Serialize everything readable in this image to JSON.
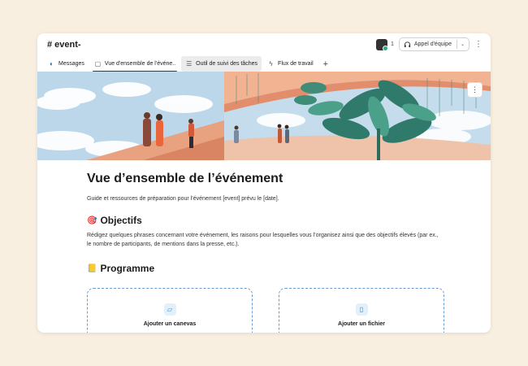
{
  "header": {
    "channel": "# event-",
    "member_count": "1",
    "call_button": "Appel d'équipe"
  },
  "tabs": [
    {
      "label": "Messages",
      "icon": "messages-icon"
    },
    {
      "label": "Vue d'ensemble de l'événe..",
      "icon": "canvas-icon"
    },
    {
      "label": "Outil de suivi des tâches",
      "icon": "list-icon"
    },
    {
      "label": "Flux de travail",
      "icon": "workflow-icon"
    }
  ],
  "document": {
    "title": "Vue d’ensemble de l’événement",
    "intro": "Guide et ressources de préparation pour l’événement [event] prévu le [date].",
    "sections": [
      {
        "emoji": "🎯",
        "heading": "Objectifs",
        "text": "Rédigez quelques phrases concernant votre événement, les raisons pour lesquelles vous l’organisez ainsi que des objectifs élevés (par ex., le nombre de participants, de mentions dans la presse, etc.)."
      },
      {
        "emoji": "📒",
        "heading": "Programme"
      }
    ]
  },
  "cards": [
    {
      "label": "Ajouter un canevas",
      "icon": "canvas-add-icon"
    },
    {
      "label": "Ajouter un fichier",
      "icon": "file-add-icon"
    }
  ],
  "colors": {
    "active_tab_underline": "#611f69",
    "card_border": "#6a9ad4",
    "card_icon": "#2e78bc",
    "background": "#f8efe0"
  }
}
